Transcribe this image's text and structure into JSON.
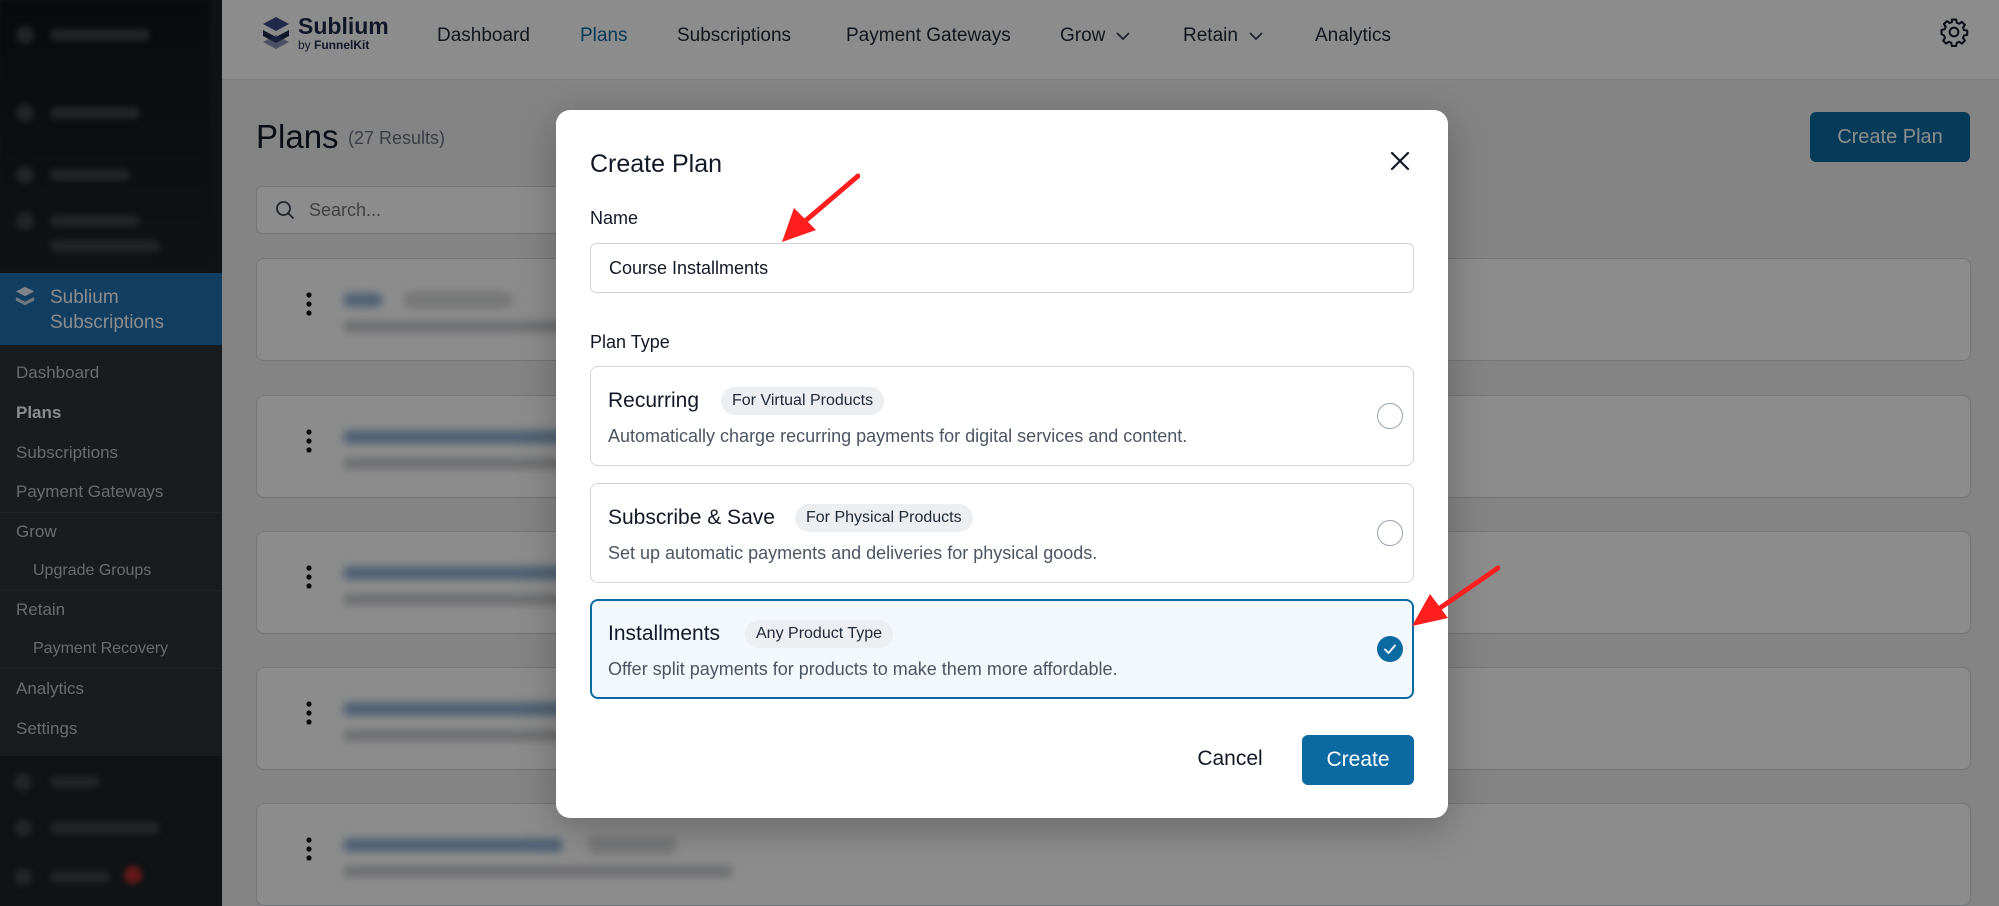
{
  "wp_sidebar": {
    "current_menu": "Sublium\nSubscriptions",
    "submenu": [
      {
        "label": "Dashboard"
      },
      {
        "label": "Plans"
      },
      {
        "label": "Subscriptions"
      },
      {
        "label": "Payment Gateways"
      },
      {
        "label": "Grow"
      },
      {
        "label": "Upgrade Groups"
      },
      {
        "label": "Retain"
      },
      {
        "label": "Payment Recovery"
      },
      {
        "label": "Analytics"
      },
      {
        "label": "Settings"
      }
    ]
  },
  "topbar": {
    "brand": "Sublium",
    "by_prefix": "by ",
    "by_brand": "FunnelKit",
    "nav": [
      {
        "label": "Dashboard"
      },
      {
        "label": "Plans"
      },
      {
        "label": "Subscriptions"
      },
      {
        "label": "Payment Gateways"
      },
      {
        "label": "Grow"
      },
      {
        "label": "Retain"
      },
      {
        "label": "Analytics"
      }
    ],
    "active_nav": "Plans",
    "settings_icon": "gear-icon"
  },
  "page": {
    "title": "Plans",
    "result_count": "(27 Results)",
    "create_button": "Create Plan",
    "search_placeholder": "Search..."
  },
  "modal": {
    "title": "Create Plan",
    "name_label": "Name",
    "name_value": "Course Installments",
    "plan_type_label": "Plan Type",
    "plan_types": [
      {
        "title": "Recurring",
        "badge": "For Virtual Products",
        "description": "Automatically charge recurring payments for digital services and content.",
        "selected": false
      },
      {
        "title": "Subscribe & Save",
        "badge": "For Physical Products",
        "description": "Set up automatic payments and deliveries for physical goods.",
        "selected": false
      },
      {
        "title": "Installments",
        "badge": "Any Product Type",
        "description": "Offer split payments for products to make them more affordable.",
        "selected": true
      }
    ],
    "cancel_label": "Cancel",
    "create_label": "Create"
  },
  "colors": {
    "primary": "#0b6aa2",
    "wp_sidebar_bg": "#1d2327",
    "wp_active": "#2271b1",
    "annotation": "#ff1e1e"
  }
}
